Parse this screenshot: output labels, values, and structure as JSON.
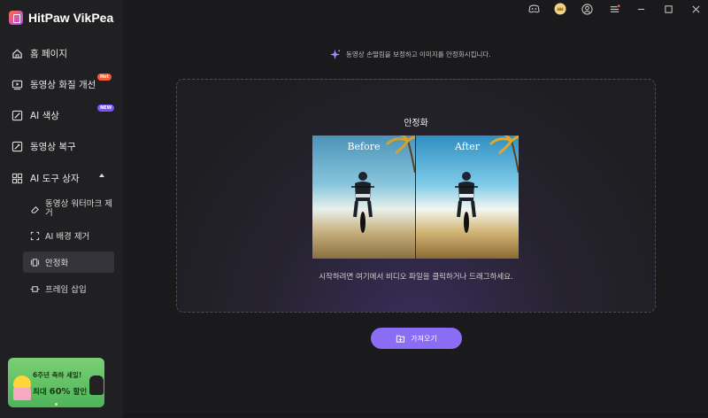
{
  "app": {
    "name": "HitPaw VikPea"
  },
  "sidebar": {
    "items": [
      {
        "label": "홈 페이지",
        "icon": "home-icon"
      },
      {
        "label": "동영상 화질 개선",
        "icon": "video-enhance-icon",
        "badge": "Hot"
      },
      {
        "label": "AI 색상",
        "icon": "ai-color-icon",
        "badge": "NEW"
      },
      {
        "label": "동영상 복구",
        "icon": "video-repair-icon"
      },
      {
        "label": "AI 도구 상자",
        "icon": "toolbox-icon"
      }
    ],
    "sub_items": [
      {
        "label": "동영상 워터마크 제거",
        "icon": "eraser-icon"
      },
      {
        "label": "AI 배경 제거",
        "icon": "ai-background-icon"
      },
      {
        "label": "안정화",
        "icon": "stabilize-icon"
      },
      {
        "label": "프레임 삽입",
        "icon": "frame-insert-icon"
      }
    ],
    "promo": {
      "line1": "6주년 축하 세일!",
      "line2_prefix": "최대",
      "line2_highlight": "60%",
      "line2_suffix": "할인"
    }
  },
  "titlebar": {
    "icons": [
      "discord-icon",
      "crown-icon",
      "user-icon",
      "menu-icon",
      "minimize-icon",
      "maximize-icon",
      "close-icon"
    ]
  },
  "main": {
    "hint": "동영상 손떨림을 보정하고 이미지를 안정화시킵니다.",
    "dropzone": {
      "title": "안정화",
      "before_label": "Before",
      "after_label": "After",
      "instruction": "시작하려면 여기에서 비디오 파일을 클릭하거나 드래그하세요."
    },
    "import_button": "가져오기"
  },
  "colors": {
    "accent": "#8b6cf5",
    "hot": "#ff5a36",
    "new": "#7b55ff",
    "background": "#1a1a1c",
    "sidebar": "#202022"
  }
}
